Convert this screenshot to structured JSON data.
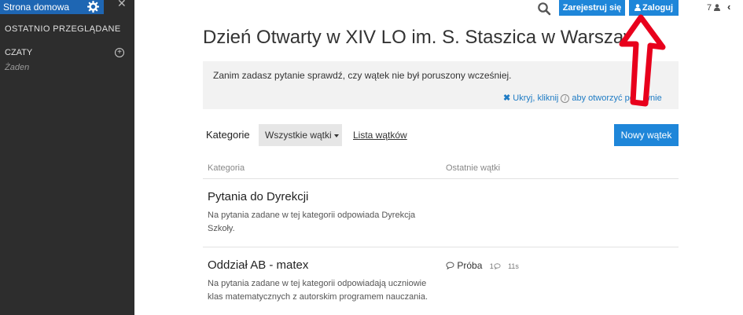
{
  "sidebar": {
    "home_label": "Strona domowa",
    "recent_label": "OSTATNIO PRZEGLĄDANE",
    "chats_label": "CZATY",
    "chats_empty": "Żaden"
  },
  "topbar": {
    "register_label": "Zarejestruj się",
    "login_label": "Zaloguj",
    "online_count": "7"
  },
  "page": {
    "title": "Dzień Otwarty w XIV LO im. S. Staszica w Warszawie"
  },
  "info": {
    "text": "Zanim zadasz pytanie sprawdź, czy wątek nie był poruszony wcześniej.",
    "hide_prefix": "Ukryj, kliknij",
    "hide_suffix": "aby otworzyć ponownie"
  },
  "filters": {
    "categories_label": "Kategorie",
    "dropdown_value": "Wszystkie wątki",
    "thread_list_link": "Lista wątków",
    "new_thread_button": "Nowy wątek"
  },
  "table": {
    "headers": [
      "Kategoria",
      "Ostatnie wątki"
    ],
    "rows": [
      {
        "title": "Pytania do Dyrekcji",
        "description": "Na pytania zadane w tej kategorii odpowiada Dyrekcja Szkoły."
      },
      {
        "title": "Oddział AB - matex",
        "description": "Na pytania zadane w tej kategorii odpowiadają uczniowie klas matematycznych z autorskim programem nauczania.",
        "recent_thread": {
          "title": "Próba",
          "replies": "1",
          "age": "11s"
        }
      }
    ]
  },
  "icons": {
    "gear": "gear-icon",
    "close": "close-icon",
    "plus": "plus-circle-icon",
    "search": "search-icon",
    "user": "user-icon",
    "info": "info-icon",
    "comment": "comment-icon"
  },
  "colors": {
    "sidebar_bg": "#2d2d2d",
    "primary": "#1e86d9",
    "info_bg": "#f2f2f2",
    "annotation_arrow": "#e8001c"
  }
}
